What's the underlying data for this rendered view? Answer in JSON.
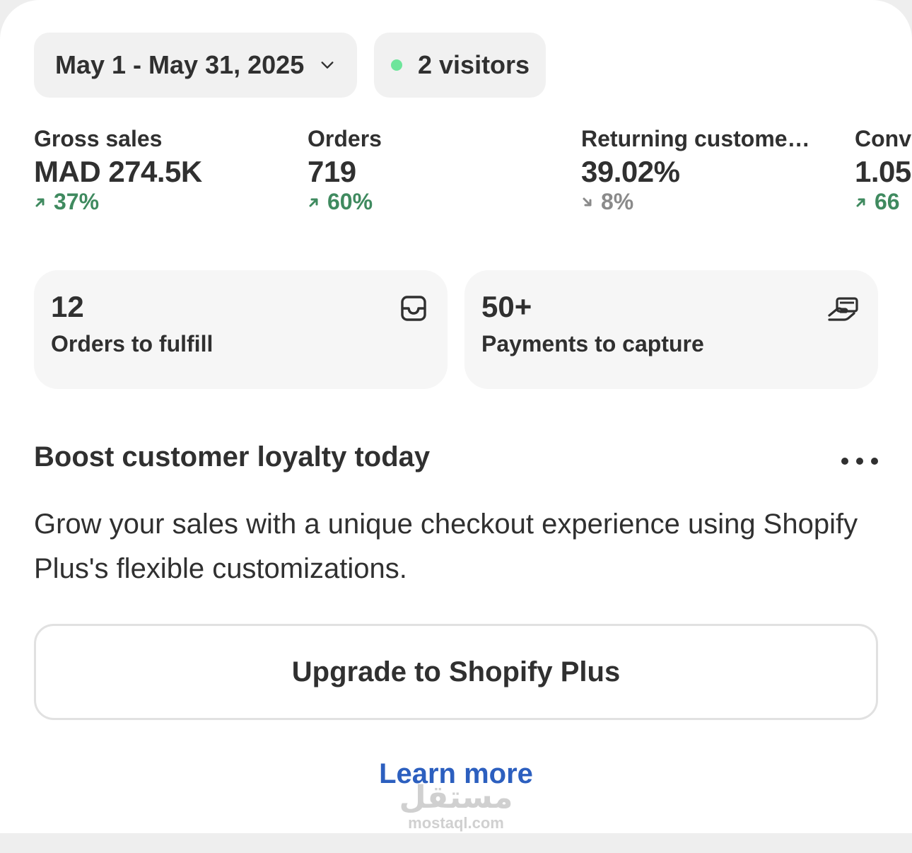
{
  "date_range": {
    "label": "May 1 - May 31, 2025",
    "icon": "chevron-down-icon"
  },
  "visitors": {
    "label": "2 visitors",
    "dot_color": "#6ee59b"
  },
  "metrics": [
    {
      "label": "Gross sales",
      "value": "MAD 274.5K",
      "delta": "37%",
      "direction": "up"
    },
    {
      "label": "Orders",
      "value": "719",
      "delta": "60%",
      "direction": "up"
    },
    {
      "label": "Returning custome…",
      "value": "39.02%",
      "delta": "8%",
      "direction": "down"
    },
    {
      "label": "Conv",
      "value": "1.05",
      "delta": "66",
      "direction": "up"
    }
  ],
  "tasks": [
    {
      "count": "12",
      "label": "Orders to fulfill",
      "icon": "inbox-icon"
    },
    {
      "count": "50+",
      "label": "Payments to capture",
      "icon": "payment-hand-icon"
    }
  ],
  "promo": {
    "title": "Boost customer loyalty today",
    "body": "Grow your sales with a unique checkout experience using Shopify Plus's flexible customizations.",
    "cta": "Upgrade to Shopify Plus",
    "link": "Learn more"
  },
  "watermark": {
    "arabic": "مستقل",
    "latin": "mostaql.com"
  },
  "colors": {
    "positive": "#3f8a5f",
    "neutral": "#8a8a8a",
    "link": "#2c5fbf"
  }
}
